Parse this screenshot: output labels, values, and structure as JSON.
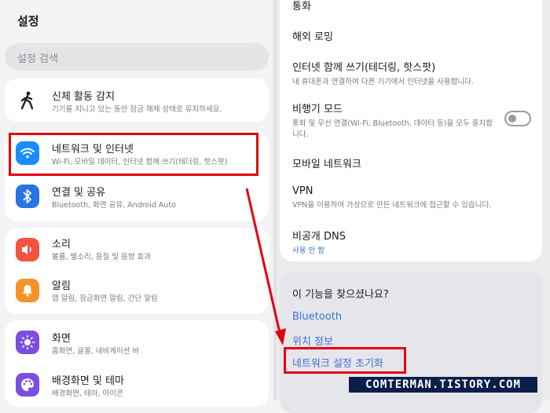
{
  "left": {
    "title": "설정",
    "search_placeholder": "설정 검색",
    "items": [
      {
        "title": "신체 활동 감지",
        "subtitle": "기기를 지니고 있는 동안 잠금 해제 상태로 유지하세요.",
        "icon": "walking-person-icon"
      },
      {
        "title": "네트워크 및 인터넷",
        "subtitle": "Wi-Fi, 모바일 데이터, 인터넷 함께 쓰기(테더링, 핫스팟)",
        "icon": "wifi-icon"
      },
      {
        "title": "연결 및 공유",
        "subtitle": "Bluetooth, 화면 공유, Android Auto",
        "icon": "bluetooth-icon"
      },
      {
        "title": "소리",
        "subtitle": "볼륨, 벨소리, 음질 및 음향 효과",
        "icon": "speaker-icon"
      },
      {
        "title": "알림",
        "subtitle": "앱 알림, 잠금화면 알림, 간단 알림",
        "icon": "bell-icon"
      },
      {
        "title": "화면",
        "subtitle": "홈화면, 글꼴, 내비게이션 바",
        "icon": "brightness-icon"
      },
      {
        "title": "배경화면 및 테마",
        "subtitle": "배경화면, 테마, 아이콘",
        "icon": "palette-icon"
      }
    ]
  },
  "right": {
    "items": [
      {
        "title": "통화"
      },
      {
        "title": "해외 로밍"
      },
      {
        "title": "인터넷 함께 쓰기(테더링, 핫스팟)",
        "subtitle": "내 휴대폰과 연결하여 다른 기기에서 인터넷을 사용합니다."
      },
      {
        "title": "비행기 모드",
        "subtitle": "통화 및 무선 연결(Wi-Fi, Bluetooth, 데이터 등)을 모두 중지합니다."
      },
      {
        "title": "모바일 네트워크"
      },
      {
        "title": "VPN",
        "subtitle": "VPN을 이용하여 가상으로 만든 네트워크에 접근할 수 있습니다."
      },
      {
        "title": "비공개 DNS",
        "subtitle": "사용 안 함"
      }
    ],
    "suggest_title": "이 기능을 찾으셨나요?",
    "links": [
      "Bluetooth",
      "위치 정보",
      "네트워크 설정 초기화"
    ]
  },
  "watermark": "COMTERMAN.TISTORY.COM",
  "colors": {
    "accent": "#3e6fd1",
    "highlight": "#e3000f",
    "wifi": "#1a8cff",
    "bluetooth": "#2873e6",
    "sound": "#f2543f",
    "bell": "#f5932a",
    "display": "#7b4de0",
    "palette": "#7b4de0"
  }
}
